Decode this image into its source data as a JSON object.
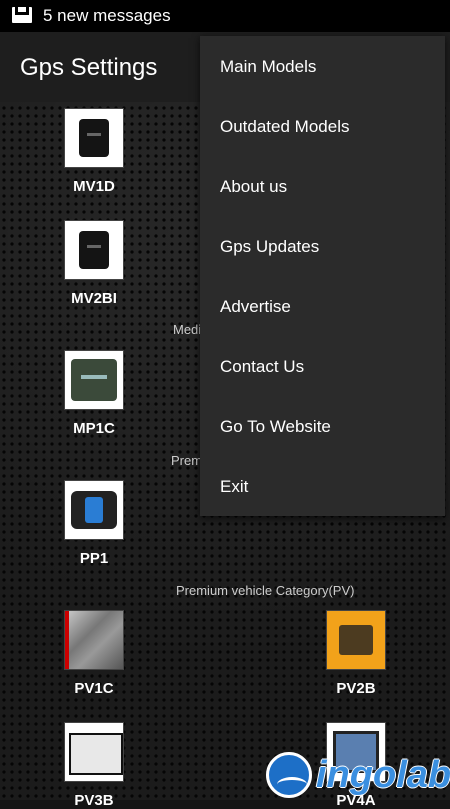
{
  "status_bar": {
    "notification": "5 new messages",
    "icon": "mail-icon"
  },
  "app_bar": {
    "title": "Gps Settings"
  },
  "menu": {
    "items": [
      {
        "label": "Main Models"
      },
      {
        "label": "Outdated Models"
      },
      {
        "label": "About us"
      },
      {
        "label": "Gps Updates"
      },
      {
        "label": "Advertise"
      },
      {
        "label": "Contact Us"
      },
      {
        "label": "Go To Website"
      },
      {
        "label": "Exit"
      }
    ]
  },
  "categories": [
    {
      "label": "Medi"
    },
    {
      "label": "Prem"
    },
    {
      "label": "Premium vehicle Category(PV)"
    }
  ],
  "products": [
    {
      "name": "MV1D"
    },
    {
      "name": "MV2BI"
    },
    {
      "name": "MP1C"
    },
    {
      "name": "PP1"
    },
    {
      "name": "PV1C"
    },
    {
      "name": "PV2B"
    },
    {
      "name": "PV3B"
    },
    {
      "name": "PV4A"
    }
  ],
  "branding": {
    "logo_text": "ingolabs"
  }
}
